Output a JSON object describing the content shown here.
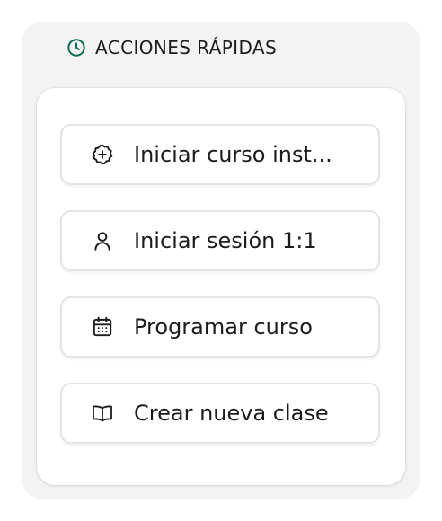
{
  "panel": {
    "title": "ACCIONES RÁPIDAS",
    "title_icon": "clock-icon",
    "accent_color": "#0f6e55"
  },
  "actions": [
    {
      "label": "Iniciar curso inst...",
      "icon": "plus-badge-icon"
    },
    {
      "label": "Iniciar sesión 1:1",
      "icon": "user-icon"
    },
    {
      "label": "Programar curso",
      "icon": "calendar-icon"
    },
    {
      "label": "Crear nueva clase",
      "icon": "book-open-icon"
    }
  ]
}
